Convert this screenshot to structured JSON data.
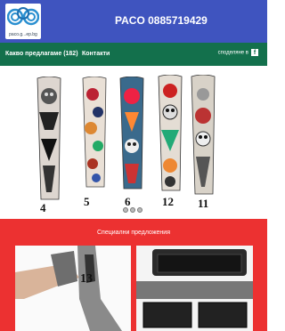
{
  "header": {
    "logo_text": "paco.g...eр.bg",
    "phone": "PACO 0885719429",
    "brand_color": "#3f54bf"
  },
  "nav": {
    "items": [
      {
        "label": "Какво предлагаме (182)"
      },
      {
        "label": "Контакти"
      }
    ],
    "share_label": "споделяне в",
    "share_icon": "facebook-icon",
    "bg_color": "#13704c"
  },
  "hero": {
    "sleeve_numbers": [
      "4",
      "5",
      "6",
      "12",
      "11"
    ],
    "carousel_dots": 3,
    "active_dot": 0
  },
  "promo": {
    "title": "Специални предложения",
    "bg_color": "#ec3131",
    "card1_number": "13"
  }
}
